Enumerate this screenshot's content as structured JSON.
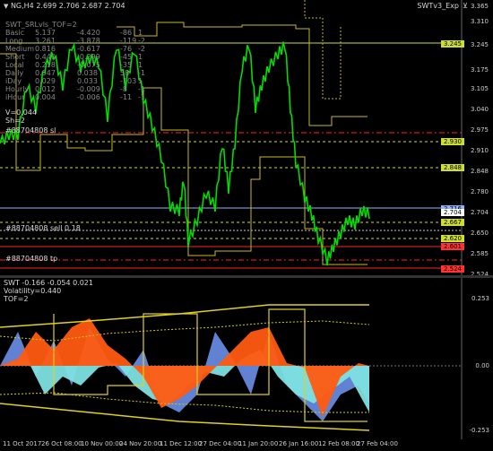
{
  "top_bar": {
    "symbol_line": "NG,H4 2.699 2.706 2.687 2.704",
    "indicator_tag": "SWTv3_Exp"
  },
  "indicator_title": "SWT_SRLvls_TOF=2",
  "table": [
    {
      "name": "Basic",
      "v1": "5.137",
      "v2": "-4.420",
      "v3": "-86",
      "v4": "1"
    },
    {
      "name": "Long",
      "v1": "3.261",
      "v2": "-3.878",
      "v3": "-119",
      "v4": "-2"
    },
    {
      "name": "Medium",
      "v1": "0.816",
      "v2": "-0.617",
      "v3": "-76",
      "v4": "-2"
    },
    {
      "name": "Short",
      "v1": "0.440",
      "v2": "-0.299",
      "v3": "-45",
      "v4": "1"
    },
    {
      "name": "Local",
      "v1": "0.218",
      "v2": "-0.075",
      "v3": "-35",
      "v4": "1"
    },
    {
      "name": "Daily",
      "v1": "0.047",
      "v2": "0.038",
      "v3": "58",
      "v4": "-1"
    },
    {
      "name": "iDay",
      "v1": "0.029",
      "v2": "0.033",
      "v3": "-103",
      "v4": "1"
    },
    {
      "name": "Hourly",
      "v1": "0.012",
      "v2": "-0.009",
      "v3": "-8",
      "v4": "-1"
    },
    {
      "name": "iHour",
      "v1": "0.004",
      "v2": "-0.006",
      "v3": "-11",
      "v4": "-1"
    }
  ],
  "extra_lines": [
    "V=0.044",
    "Sh=2"
  ],
  "chart_labels": {
    "sl": "#88704808 sl",
    "sell": "#88704808 sell 0.18",
    "tp": "#88704808 tp"
  },
  "price_axis": [
    "3.365",
    "3.310",
    "3.245",
    "3.175",
    "3.105",
    "3.040",
    "2.975",
    "2.910",
    "2.848",
    "2.780",
    "2.704",
    "2.650",
    "2.585",
    "2.524",
    "2.455"
  ],
  "price_tags": [
    {
      "label": "3.245",
      "color": "#ccdd33"
    },
    {
      "label": "2.930",
      "color": "#ccdd33"
    },
    {
      "label": "2.848",
      "color": "#ccdd33"
    },
    {
      "label": "2.716",
      "color": "#8fb4ff"
    },
    {
      "label": "2.704",
      "color": "#ffffff"
    },
    {
      "label": "2.667",
      "color": "#ccdd33"
    },
    {
      "label": "2.620",
      "color": "#ccdd33"
    },
    {
      "label": "2.601",
      "color": "#ff3333"
    },
    {
      "label": "2.524",
      "color": "#ff3333"
    }
  ],
  "sub_window": {
    "title": "SWT -0.166 -0.054 0.021",
    "line2": "Volatility=0.440",
    "line3": "TOF=2",
    "axis_top": "0.253",
    "axis_mid": "0.00",
    "axis_bot": "-0.253"
  },
  "time_axis": [
    "11 Oct 2017",
    "26 Oct 08:00",
    "10 Nov 00:00",
    "24 Nov 20:00",
    "11 Dec 12:00",
    "27 Dec 04:00",
    "11 Jan 20:00",
    "26 Jan 16:00",
    "12 Feb 08:00",
    "27 Feb 04:00"
  ],
  "colors": {
    "candles": "#00dd00",
    "level_line": "#ccdd33",
    "red_line": "#ff2222",
    "current_price": "#8fb4ff",
    "orange_fill": "#ff5a10",
    "cyan_fill": "#7ee0e0",
    "blue_fill": "#6688dd"
  }
}
